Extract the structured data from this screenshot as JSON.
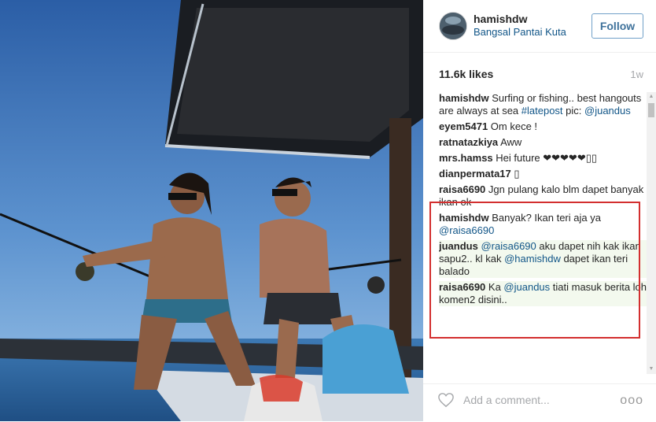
{
  "post": {
    "username": "hamishdw",
    "location": "Bangsal Pantai Kuta",
    "follow_label": "Follow",
    "likes": "11.6k likes",
    "age": "1w"
  },
  "comments": [
    {
      "user": "hamishdw",
      "parts": [
        {
          "text": "Surfing or fishing.. best hangouts are always at sea "
        },
        {
          "text": "#latepost",
          "link": true
        },
        {
          "text": " pic: "
        },
        {
          "text": "@juandus",
          "link": true
        }
      ]
    },
    {
      "user": "eyem5471",
      "parts": [
        {
          "text": "Om kece !"
        }
      ]
    },
    {
      "user": "ratnatazkiya",
      "parts": [
        {
          "text": "Aww"
        }
      ]
    },
    {
      "user": "mrs.hamss",
      "parts": [
        {
          "text": "Hei future ❤❤❤❤❤▯▯"
        }
      ]
    },
    {
      "user": "dianpermata17",
      "parts": [
        {
          "text": "▯"
        }
      ]
    },
    {
      "user": "raisa6690",
      "parts": [
        {
          "text": "Jgn pulang kalo blm dapet banyak ikan ok"
        }
      ]
    },
    {
      "user": "hamishdw",
      "parts": [
        {
          "text": "Banyak? Ikan teri aja ya "
        },
        {
          "text": "@raisa6690",
          "link": true
        }
      ]
    },
    {
      "user": "juandus",
      "highlight": true,
      "parts": [
        {
          "text": "@raisa6690",
          "link": true
        },
        {
          "text": " aku dapet nih kak ikan sapu2.. kl kak "
        },
        {
          "text": "@hamishdw",
          "link": true
        },
        {
          "text": " dapet ikan teri balado"
        }
      ]
    },
    {
      "user": "raisa6690",
      "highlight": true,
      "parts": [
        {
          "text": "Ka "
        },
        {
          "text": "@juandus",
          "link": true
        },
        {
          "text": " tiati masuk berita loh komen2 disini.."
        }
      ]
    }
  ],
  "footer": {
    "add_comment_placeholder": "Add a comment...",
    "more_label": "ooo"
  },
  "icons": {
    "heart": "heart-outline-icon",
    "more": "more-options-icon"
  },
  "colors": {
    "link": "#125688",
    "follow_border": "#70a0c8",
    "highlight_box": "#d32f2f"
  }
}
